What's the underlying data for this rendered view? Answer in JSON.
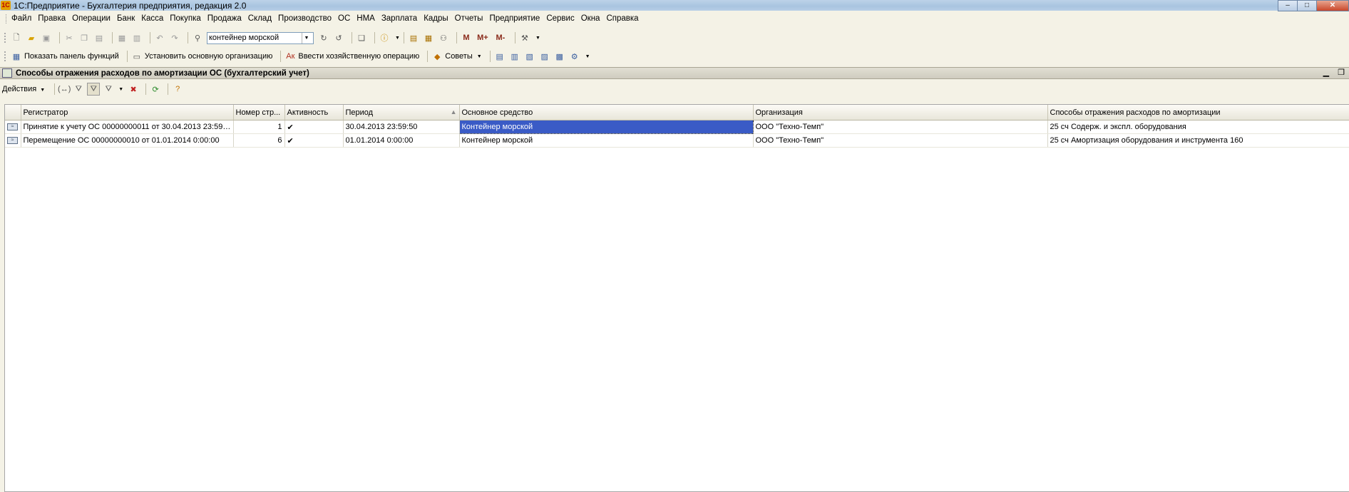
{
  "window": {
    "title": "1С:Предприятие - Бухгалтерия предприятия, редакция 2.0",
    "controls": [
      "–",
      "□",
      "✕"
    ]
  },
  "menu": [
    "Файл",
    "Правка",
    "Операции",
    "Банк",
    "Касса",
    "Покупка",
    "Продажа",
    "Склад",
    "Производство",
    "ОС",
    "НМА",
    "Зарплата",
    "Кадры",
    "Отчеты",
    "Предприятие",
    "Сервис",
    "Окна",
    "Справка"
  ],
  "toolbar": {
    "search_value": "контейнер морской",
    "m_label": "M",
    "mplus_label": "M+",
    "mminus_label": "M-"
  },
  "toolbar2": {
    "show_panel": "Показать панель функций",
    "set_org": "Установить основную организацию",
    "enter_op": "Ввести хозяйственную операцию",
    "tips": "Советы"
  },
  "form": {
    "title": "Способы отражения расходов по амортизации ОС (бухгалтерский учет)"
  },
  "actions": {
    "label": "Действия"
  },
  "table": {
    "columns": [
      "Регистратор",
      "Номер стр...",
      "Активность",
      "Период",
      "Основное средство",
      "Организация",
      "Способы отражения расходов по амортизации"
    ],
    "rows": [
      {
        "registrar": "Принятие к учету ОС 00000000011 от 30.04.2013 23:59:...",
        "line": "1",
        "active": "✔",
        "period": "30.04.2013 23:59:50",
        "asset": "Контейнер морской",
        "org": "ООО \"Техно-Темп\"",
        "method": "25 сч Содерж. и экспл. оборудования"
      },
      {
        "registrar": "Перемещение ОС 00000000010 от 01.01.2014 0:00:00",
        "line": "6",
        "active": "✔",
        "period": "01.01.2014 0:00:00",
        "asset": "Контейнер морской",
        "org": "ООО \"Техно-Темп\"",
        "method": "25 сч  Амортизация оборудования и инструмента 160"
      }
    ]
  }
}
